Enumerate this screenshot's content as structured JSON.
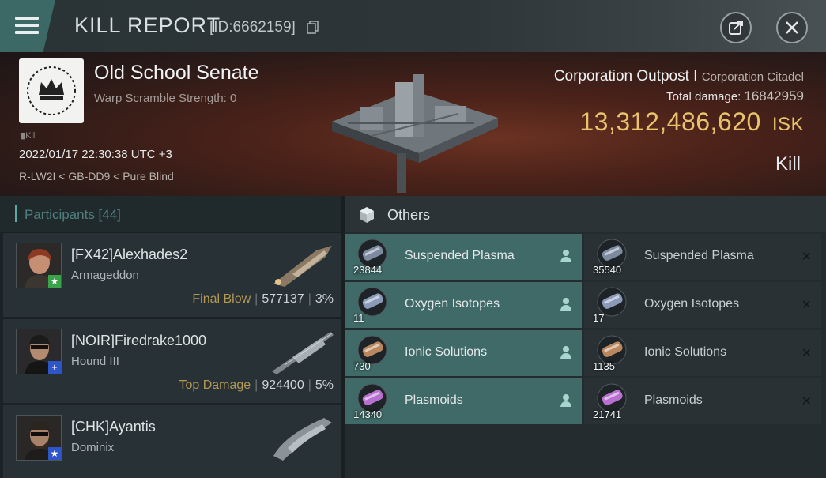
{
  "titlebar": {
    "title": "KILL REPORT",
    "report_id": "[ID:6662159]"
  },
  "victim": {
    "name": "Old School Senate",
    "warp_scramble": "Warp Scramble Strength: 0",
    "kill_tag": "Kill",
    "time": "2022/01/17 22:30:38 UTC +3",
    "location": "R-LW2I < GB-DD9 < Pure Blind",
    "ship_type": "Corporation Outpost I",
    "ship_class": "Corporation Citadel",
    "total_damage_label": "Total damage:",
    "total_damage": "16842959",
    "isk_value": "13,312,486,620",
    "isk_unit": "ISK",
    "result": "Kill"
  },
  "participants": {
    "header": "Participants [44]",
    "rows": [
      {
        "name": "[FX42]Alexhades2",
        "ship": "Armageddon",
        "tag": "Final Blow",
        "damage": "577137",
        "percent": "3%",
        "badge": "★",
        "badge_color": "#3aa34a"
      },
      {
        "name": "[NOIR]Firedrake1000",
        "ship": "Hound III",
        "tag": "Top Damage",
        "damage": "924400",
        "percent": "5%",
        "badge": "+",
        "badge_color": "#2f56c9"
      },
      {
        "name": "[CHK]Ayantis",
        "ship": "Dominix",
        "tag": "",
        "damage": "",
        "percent": "",
        "badge": "★",
        "badge_color": "#2f56c9"
      }
    ]
  },
  "others": {
    "header": "Others",
    "dropped": [
      {
        "name": "Suspended Plasma",
        "qty": "23844",
        "color": "#7d8aa0"
      },
      {
        "name": "Oxygen Isotopes",
        "qty": "11",
        "color": "#8a9ab8"
      },
      {
        "name": "Ionic Solutions",
        "qty": "730",
        "color": "#b9875e"
      },
      {
        "name": "Plasmoids",
        "qty": "14340",
        "color": "#b76fd0"
      }
    ],
    "destroyed": [
      {
        "name": "Suspended Plasma",
        "qty": "35540",
        "color": "#7d8aa0"
      },
      {
        "name": "Oxygen Isotopes",
        "qty": "17",
        "color": "#8a9ab8"
      },
      {
        "name": "Ionic Solutions",
        "qty": "1135",
        "color": "#b9875e"
      },
      {
        "name": "Plasmoids",
        "qty": "21741",
        "color": "#b76fd0"
      }
    ]
  }
}
